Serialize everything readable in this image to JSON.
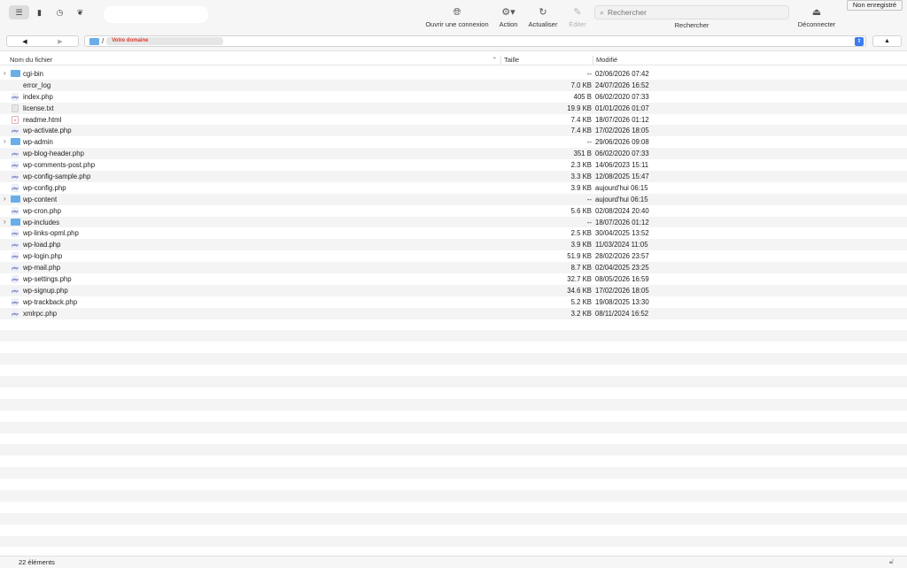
{
  "toolbar": {
    "tools": [
      {
        "label": "Ouvrir une connexion",
        "icon": "globe-plus-icon"
      },
      {
        "label": "Action",
        "icon": "gear-icon"
      },
      {
        "label": "Actualiser",
        "icon": "refresh-icon"
      },
      {
        "label": "Éditer",
        "icon": "pencil-icon"
      }
    ],
    "search_placeholder": "Rechercher",
    "search_label": "Rechercher",
    "disconnect_label": "Déconnecter",
    "badge": "Non enregistré"
  },
  "path": {
    "slash": "/",
    "crumb": "Votre domaine"
  },
  "columns": {
    "name": "Nom du fichier",
    "size": "Taille",
    "modified": "Modifié"
  },
  "files": [
    {
      "name": "cgi-bin",
      "type": "folder",
      "size": "--",
      "modified": "02/06/2026 07:42"
    },
    {
      "name": "error_log",
      "type": "blank",
      "size": "7.0 KB",
      "modified": "24/07/2026 16:52"
    },
    {
      "name": "index.php",
      "type": "php",
      "size": "405 B",
      "modified": "06/02/2020 07:33"
    },
    {
      "name": "license.txt",
      "type": "doc",
      "size": "19.9 KB",
      "modified": "01/01/2026 01:07"
    },
    {
      "name": "readme.html",
      "type": "html",
      "size": "7.4 KB",
      "modified": "18/07/2026 01:12"
    },
    {
      "name": "wp-activate.php",
      "type": "php",
      "size": "7.4 KB",
      "modified": "17/02/2026 18:05"
    },
    {
      "name": "wp-admin",
      "type": "folder",
      "size": "--",
      "modified": "29/06/2026 09:08"
    },
    {
      "name": "wp-blog-header.php",
      "type": "php",
      "size": "351 B",
      "modified": "06/02/2020 07:33"
    },
    {
      "name": "wp-comments-post.php",
      "type": "php",
      "size": "2.3 KB",
      "modified": "14/06/2023 15:11"
    },
    {
      "name": "wp-config-sample.php",
      "type": "php",
      "size": "3.3 KB",
      "modified": "12/08/2025 15:47"
    },
    {
      "name": "wp-config.php",
      "type": "php",
      "size": "3.9 KB",
      "modified": "aujourd'hui 06:15"
    },
    {
      "name": "wp-content",
      "type": "folder",
      "size": "--",
      "modified": "aujourd'hui 06:15"
    },
    {
      "name": "wp-cron.php",
      "type": "php",
      "size": "5.6 KB",
      "modified": "02/08/2024 20:40"
    },
    {
      "name": "wp-includes",
      "type": "folder",
      "size": "--",
      "modified": "18/07/2026 01:12"
    },
    {
      "name": "wp-links-opml.php",
      "type": "php",
      "size": "2.5 KB",
      "modified": "30/04/2025 13:52"
    },
    {
      "name": "wp-load.php",
      "type": "php",
      "size": "3.9 KB",
      "modified": "11/03/2024 11:05"
    },
    {
      "name": "wp-login.php",
      "type": "php",
      "size": "51.9 KB",
      "modified": "28/02/2026 23:57"
    },
    {
      "name": "wp-mail.php",
      "type": "php",
      "size": "8.7 KB",
      "modified": "02/04/2025 23:25"
    },
    {
      "name": "wp-settings.php",
      "type": "php",
      "size": "32.7 KB",
      "modified": "08/05/2026 16:59"
    },
    {
      "name": "wp-signup.php",
      "type": "php",
      "size": "34.6 KB",
      "modified": "17/02/2026 18:05"
    },
    {
      "name": "wp-trackback.php",
      "type": "php",
      "size": "5.2 KB",
      "modified": "19/08/2025 13:30"
    },
    {
      "name": "xmlrpc.php",
      "type": "php",
      "size": "3.2 KB",
      "modified": "08/11/2024 16:52"
    }
  ],
  "status": {
    "count": "22 éléments"
  }
}
